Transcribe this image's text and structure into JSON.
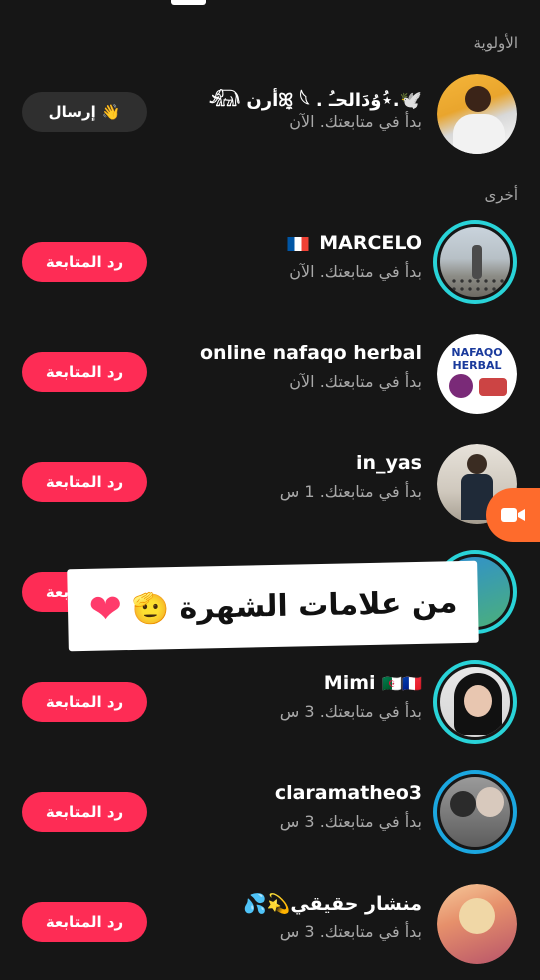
{
  "sections": {
    "priority": "الأولوية",
    "others": "أخرى"
  },
  "buttons": {
    "send": "إرسال",
    "follow_back": "رد المتابعة"
  },
  "icons": {
    "wave": "👋",
    "video": "video-icon"
  },
  "rows": [
    {
      "name": "🕊️.⋆ُوُدَالحـُ . ꕤ̼ 𓆩أرن 𓃰",
      "status": "بدأ في متابعتك. الآن",
      "action": "send"
    },
    {
      "name": "MARCELO",
      "status": "بدأ في متابعتك. الآن",
      "action": "follow_back",
      "flag": "fr"
    },
    {
      "name": "online nafaqo herbal",
      "status": "بدأ في متابعتك. الآن",
      "action": "follow_back",
      "avatar_text": "NAFAQO HERBAL"
    },
    {
      "name": "in_yas",
      "status": "بدأ في متابعتك. 1 س",
      "action": "follow_back"
    },
    {
      "name": "",
      "status": "",
      "action": "follow_back"
    },
    {
      "name": "Mimi",
      "status": "بدأ في متابعتك. 3 س",
      "action": "follow_back",
      "flags": "🇩🇿🇫🇷"
    },
    {
      "name": "claramatheo3",
      "status": "بدأ في متابعتك. 3 س",
      "action": "follow_back"
    },
    {
      "name": "منشار حقيقي💫💦",
      "status": "بدأ في متابعتك. 3 س",
      "action": "follow_back"
    }
  ],
  "overlay": {
    "text": "من علامات الشهرة",
    "emoji": "🫡",
    "heart": "❤"
  },
  "colors": {
    "accent": "#fe2c55",
    "ring": "#29d3d8",
    "video_fab": "#fe6b2c"
  }
}
